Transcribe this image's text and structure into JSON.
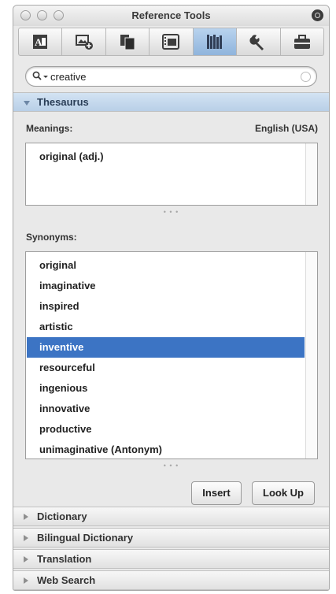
{
  "window": {
    "title": "Reference Tools"
  },
  "toolbar": {
    "tools": [
      {
        "icon": "text-format-icon",
        "active": false
      },
      {
        "icon": "insert-picture-icon",
        "active": false
      },
      {
        "icon": "copy-pages-icon",
        "active": false
      },
      {
        "icon": "media-browser-icon",
        "active": false
      },
      {
        "icon": "reference-books-icon",
        "active": true
      },
      {
        "icon": "wrench-icon",
        "active": false
      },
      {
        "icon": "toolbox-icon",
        "active": false
      }
    ]
  },
  "search": {
    "value": "creative"
  },
  "thesaurus": {
    "header": "Thesaurus",
    "meanings_label": "Meanings:",
    "language": "English (USA)",
    "meanings": [
      "original (adj.)"
    ],
    "synonyms_label": "Synonyms:",
    "synonyms": [
      "original",
      "imaginative",
      "inspired",
      "artistic",
      "inventive",
      "resourceful",
      "ingenious",
      "innovative",
      "productive",
      "unimaginative (Antonym)"
    ],
    "selected_index": 4,
    "insert_label": "Insert",
    "lookup_label": "Look Up"
  },
  "sections": [
    {
      "label": "Dictionary"
    },
    {
      "label": "Bilingual Dictionary"
    },
    {
      "label": "Translation"
    },
    {
      "label": "Web Search"
    }
  ],
  "colors": {
    "selection": "#3c74c4",
    "active_tool": "#a8c6e6"
  }
}
